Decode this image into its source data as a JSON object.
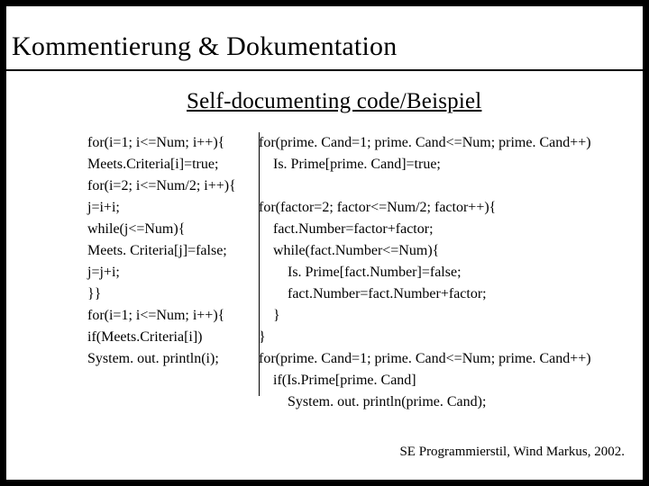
{
  "title": "Kommentierung & Dokumentation",
  "subtitle": "Self-documenting code/Beispiel",
  "footer": "SE Programmierstil, Wind Markus, 2002.",
  "rows": [
    {
      "l": "for(i=1; i<=Num; i++){",
      "r": "for(prime. Cand=1; prime. Cand<=Num; prime. Cand++)"
    },
    {
      "l": "Meets.Criteria[i]=true;",
      "r": "    Is. Prime[prime. Cand]=true;"
    },
    {
      "l": "for(i=2; i<=Num/2; i++){",
      "r": ""
    },
    {
      "l": "j=i+i;",
      "r": "for(factor=2; factor<=Num/2; factor++){"
    },
    {
      "l": "while(j<=Num){",
      "r": "    fact.Number=factor+factor;"
    },
    {
      "l": "Meets. Criteria[j]=false;",
      "r": "    while(fact.Number<=Num){"
    },
    {
      "l": "j=j+i;",
      "r": "        Is. Prime[fact.Number]=false;"
    },
    {
      "l": "}}",
      "r": "        fact.Number=fact.Number+factor;"
    },
    {
      "l": "for(i=1; i<=Num; i++){",
      "r": "    }"
    },
    {
      "l": "if(Meets.Criteria[i])",
      "r": "}"
    },
    {
      "l": "System. out. println(i);",
      "r": "for(prime. Cand=1; prime. Cand<=Num; prime. Cand++)"
    },
    {
      "l": "",
      "r": "    if(Is.Prime[prime. Cand]"
    },
    {
      "l": "",
      "r": "        System. out. println(prime. Cand);"
    }
  ]
}
